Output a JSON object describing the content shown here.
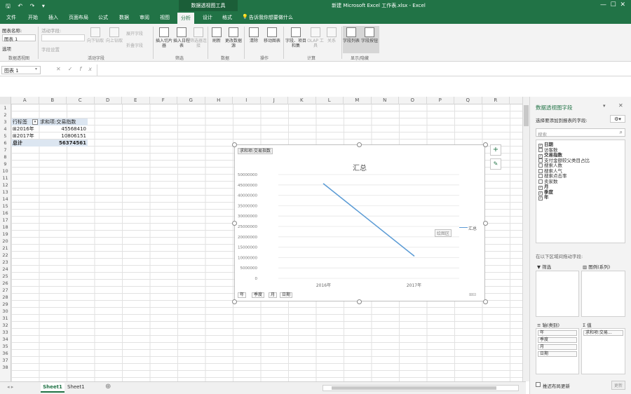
{
  "titlebar": {
    "context": "数据透视图工具",
    "title": "新建 Microsoft Excel 工作表.xlsx - Excel",
    "quick_access": "🖫 ↶ ↷ ▾"
  },
  "tabs": [
    "文件",
    "开始",
    "插入",
    "页面布局",
    "公式",
    "数据",
    "审阅",
    "视图",
    "分析",
    "设计",
    "格式"
  ],
  "active_tab": "分析",
  "tell_me": "告诉我你想要做什么",
  "ribbon": {
    "chart_name_label": "图表名称:",
    "chart_name_value": "图表 1",
    "options_label": "选项",
    "active_field_label": "活动字段:",
    "field_settings": "字段设置",
    "drill_down": "向下钻取",
    "drill_up": "向上钻取",
    "expand_field": "展开字段",
    "collapse_field": "折叠字段",
    "insert_slicer": "插入切片器",
    "insert_timeline": "插入日程表",
    "filter_connections": "筛选器连接",
    "refresh": "刷新",
    "change_source": "更改数据源",
    "clear": "清除",
    "move_chart": "移动图表",
    "fields_items": "字段、项目和集",
    "olap_tools": "OLAP 工具",
    "relationships": "关系",
    "field_list": "字段列表",
    "field_buttons": "字段按钮",
    "groups": [
      "数据透视图",
      "活动字段",
      "筛选",
      "数据",
      "操作",
      "计算",
      "显示/隐藏"
    ]
  },
  "formula_bar": {
    "name_box": "图表 1",
    "cancel": "✕",
    "enter": "✓",
    "fx": "fx"
  },
  "columns": [
    "A",
    "B",
    "C",
    "D",
    "E",
    "F",
    "G",
    "H",
    "I",
    "J",
    "K",
    "L",
    "M",
    "N",
    "O",
    "P",
    "Q",
    "R"
  ],
  "rows": [
    "1",
    "2",
    "3",
    "4",
    "5",
    "6",
    "7",
    "8",
    "9",
    "10",
    "11",
    "12",
    "13",
    "14",
    "15",
    "16",
    "17",
    "18",
    "19",
    "20",
    "21",
    "22",
    "23",
    "24",
    "25",
    "26",
    "27",
    "28",
    "29",
    "30",
    "31",
    "32",
    "33",
    "34",
    "35",
    "36",
    "37",
    "38"
  ],
  "pivot": {
    "header_label": "行标签",
    "header_value": "求和项:交易指数",
    "rows": [
      {
        "label": "⊞2016年",
        "value": "45568410"
      },
      {
        "label": "⊞2017年",
        "value": "10806151"
      }
    ],
    "total_label": "总计",
    "total_value": "56374561"
  },
  "chart_data": {
    "type": "line",
    "title": "汇总",
    "categories": [
      "2016年",
      "2017年"
    ],
    "series": [
      {
        "name": "汇总",
        "values": [
          45568410,
          10806151
        ]
      }
    ],
    "ylim": [
      0,
      50000000
    ],
    "yticks": [
      "50000000",
      "45000000",
      "40000000",
      "35000000",
      "30000000",
      "25000000",
      "20000000",
      "15000000",
      "10000000",
      "5000000",
      "0"
    ],
    "value_button": "求和项:交易指数",
    "axis_buttons": [
      "年",
      "季度",
      "月",
      "日期"
    ],
    "legend": "汇总",
    "plot_area_label": "绘图区",
    "line_color": "#5b9bd5"
  },
  "chart_side_buttons": {
    "add": "+",
    "style": "✎"
  },
  "sheets": [
    "Sheet1",
    "Sheet1"
  ],
  "add_sheet": "⊕",
  "field_panel": {
    "title": "数据透视图字段",
    "subtitle": "选择要添加到报表的字段:",
    "search_placeholder": "搜索",
    "fields": [
      {
        "name": "日期",
        "checked": true
      },
      {
        "name": "访客数",
        "checked": false
      },
      {
        "name": "交易指数",
        "checked": true
      },
      {
        "name": "支付金额较父类目占比",
        "checked": false
      },
      {
        "name": "搜索人数",
        "checked": false
      },
      {
        "name": "搜索人气",
        "checked": false
      },
      {
        "name": "搜索点击率",
        "checked": false
      },
      {
        "name": "卖家数",
        "checked": false
      },
      {
        "name": "月",
        "checked": true
      },
      {
        "name": "季度",
        "checked": true
      },
      {
        "name": "年",
        "checked": true
      }
    ],
    "drag_hint": "在以下区域间拖动字段:",
    "filters_label": "筛选",
    "legend_label": "图例(系列)",
    "axis_label": "轴(类别)",
    "values_label": "值",
    "axis_items": [
      "年",
      "季度",
      "月",
      "日期"
    ],
    "value_items": [
      "求和项:交易..."
    ],
    "defer_label": "推迟布局更新",
    "update_button": "更新"
  }
}
